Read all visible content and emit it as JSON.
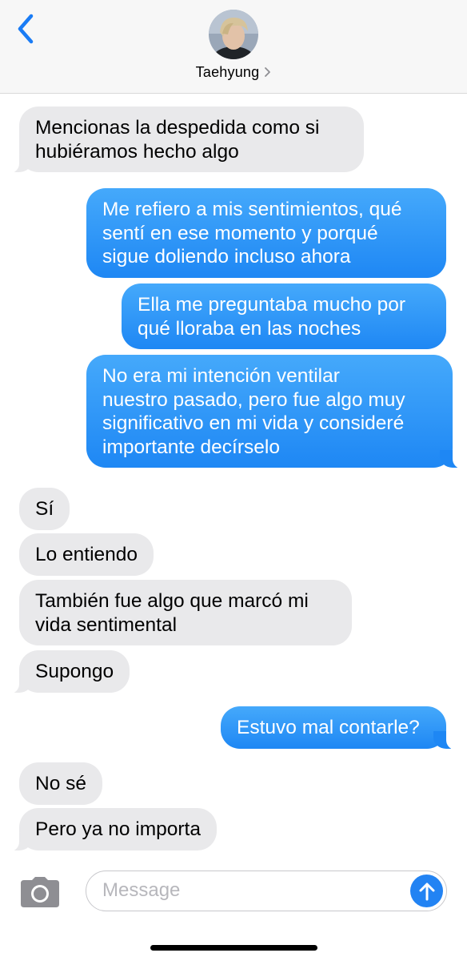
{
  "header": {
    "contact_name": "Taehyung",
    "icons": {
      "back": "chevron-left-icon",
      "contact_details": "chevron-right-icon",
      "avatar": "contact-avatar"
    }
  },
  "messages": [
    {
      "direction": "incoming",
      "lines": [
        "Mencionas la despedida como si",
        "hubiéramos hecho algo"
      ]
    },
    {
      "direction": "outgoing",
      "lines": [
        "Me refiero a mis sentimientos, qué",
        "sentí en ese momento y porqué",
        "sigue doliendo incluso ahora"
      ]
    },
    {
      "direction": "outgoing",
      "lines": [
        "Ella me preguntaba mucho por",
        "qué lloraba en las noches"
      ]
    },
    {
      "direction": "outgoing",
      "lines": [
        "No era mi intención ventilar",
        "nuestro pasado, pero fue algo muy",
        "significativo en mi vida y consideré",
        "importante decírselo"
      ]
    },
    {
      "direction": "incoming",
      "lines": [
        "Sí"
      ]
    },
    {
      "direction": "incoming",
      "lines": [
        "Lo entiendo"
      ]
    },
    {
      "direction": "incoming",
      "lines": [
        "También fue algo que marcó mi",
        "vida sentimental"
      ]
    },
    {
      "direction": "incoming",
      "lines": [
        "Supongo"
      ]
    },
    {
      "direction": "outgoing",
      "lines": [
        "Estuvo mal contarle?"
      ]
    },
    {
      "direction": "incoming",
      "lines": [
        "No sé"
      ]
    },
    {
      "direction": "incoming",
      "lines": [
        "Pero ya no importa"
      ]
    }
  ],
  "composer": {
    "placeholder": "Message",
    "icons": {
      "camera": "camera-icon",
      "send": "arrow-up-icon"
    }
  },
  "colors": {
    "incoming_bubble": "#e9e9eb",
    "outgoing_bubble": "#2e8ff7",
    "accent": "#2283f3",
    "header_bg": "#f7f7f7"
  }
}
